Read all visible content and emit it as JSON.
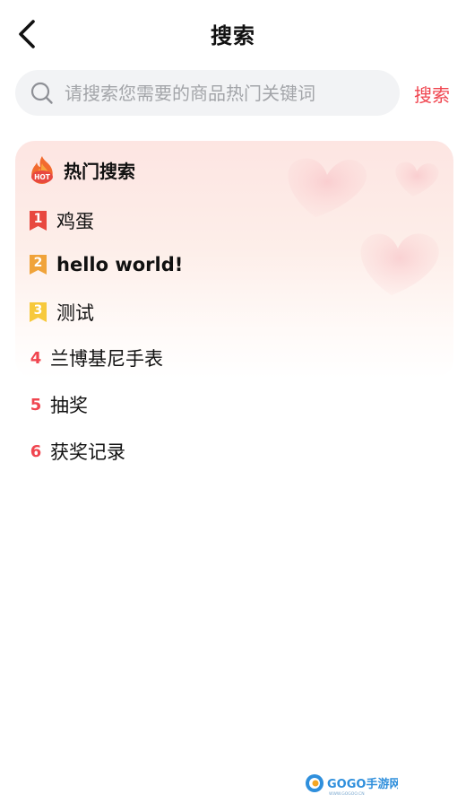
{
  "header": {
    "title": "搜索",
    "back_icon": "chevron-left-icon"
  },
  "search": {
    "placeholder": "请搜索您需要的商品热门关键词",
    "value": "",
    "button_label": "搜索",
    "icon": "search-icon"
  },
  "hot": {
    "title": "热门搜索",
    "icon_badge": "HOT",
    "items": [
      {
        "rank": "1",
        "label": "鸡蛋",
        "badge_color": "#e8483f"
      },
      {
        "rank": "2",
        "label": "hello world!",
        "badge_color": "#f0a33a"
      },
      {
        "rank": "3",
        "label": "测试",
        "badge_color": "#f7c93c"
      },
      {
        "rank": "4",
        "label": "兰博基尼手表"
      },
      {
        "rank": "5",
        "label": "抽奖"
      },
      {
        "rank": "6",
        "label": "获奖记录"
      }
    ]
  },
  "colors": {
    "accent": "#f0454f",
    "search_bg": "#f2f3f5",
    "placeholder": "#a3a5a9"
  },
  "watermark": {
    "brand": "GOGO手游网",
    "url": "WWW.GOGOO.CN"
  }
}
